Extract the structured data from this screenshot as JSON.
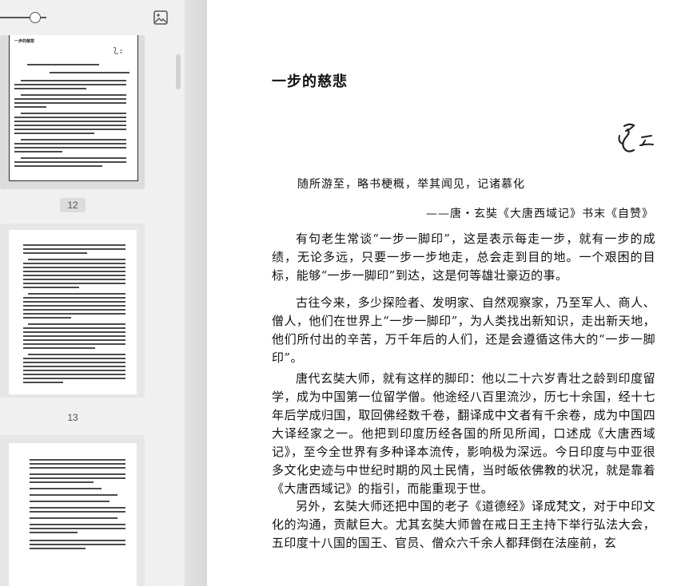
{
  "sidebar": {
    "thumbnails": [
      {
        "page_label": "12",
        "title": "一步的慈悲"
      },
      {
        "page_label": "13"
      },
      {
        "page_label": ""
      }
    ]
  },
  "document": {
    "title": "一步的慈悲",
    "epigraph": "随所游至，略书梗概，举其闻见，记诸慕化",
    "source": "——唐・玄奘《大唐西域记》书末《自赞》",
    "paragraphs": [
      "有句老生常谈“一步一脚印”，这是表示每走一步，就有一步的成绩，无论多远，只要一步一步地走，总会走到目的地。一个艰困的目标，能够“一步一脚印”到达，这是何等雄壮豪迈的事。",
      "古往今来，多少探险者、发明家、自然观察家，乃至军人、商人、僧人，他们在世界上“一步一脚印”，为人类找出新知识，走出新天地，他们所付出的辛苦，万千年后的人们，还是会遵循这伟大的“一步一脚印”。",
      "唐代玄奘大师，就有这样的脚印：他以二十六岁青壮之龄到印度留学，成为中国第一位留学僧。他途经八百里流沙，历七十余国，经十七年后学成归国，取回佛经数千卷，翻译成中文者有千余卷，成为中国四大译经家之一。他把到印度历经各国的所见所闻，口述成《大唐西域记》，至今全世界有多种译本流传，影响极为深远。今日印度与中亚很多文化史迹与中世纪时期的风土民情，当时皈依佛教的状况，就是靠着《大唐西域记》的指引，而能重现于世。",
      "另外，玄奘大师还把中国的老子《道德经》译成梵文，对于中印文化的沟通，贡献巨大。尤其玄奘大师曾在戒日王主持下举行弘法大会，五印度十八国的国王、官员、僧众六千余人都拜倒在法座前，玄"
    ]
  }
}
